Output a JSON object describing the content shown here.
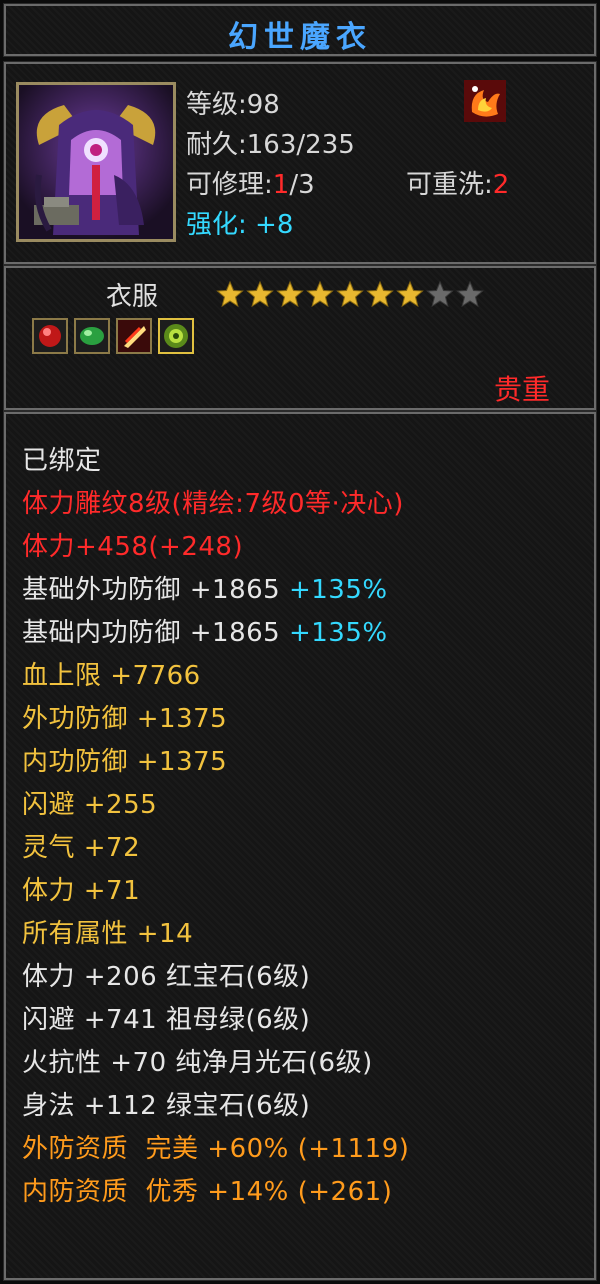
{
  "item": {
    "name": "幻世魔衣",
    "level_label": "等级:",
    "level": "98",
    "durability_label": "耐久:",
    "durability": "163/235",
    "repair_label": "可修理:",
    "repair_current": "1",
    "repair_max": "/3",
    "rewash_label": "可重洗:",
    "rewash_value": "2",
    "enhance_label": "强化: ",
    "enhance_value": "+8",
    "slot": "衣服",
    "stars_total": 9,
    "stars_filled": 7,
    "rarity": "贵重",
    "icon": "costume-armor-icon",
    "badge_icon": "flame-bird-badge-icon",
    "gem_icons": [
      "ruby-gem-icon",
      "emerald-gem-icon",
      "fire-gem-icon",
      "moonstone-gem-icon"
    ]
  },
  "stats": [
    {
      "parts": [
        {
          "text": "已绑定",
          "color": "white"
        }
      ]
    },
    {
      "parts": [
        {
          "text": "体力雕纹8级(精绘:7级0等·决心)",
          "color": "red"
        }
      ]
    },
    {
      "parts": [
        {
          "text": "体力+458(+248)",
          "color": "red"
        }
      ]
    },
    {
      "parts": [
        {
          "text": "基础外功防御 +1865 ",
          "color": "white"
        },
        {
          "text": "+135%",
          "color": "cyan"
        }
      ]
    },
    {
      "parts": [
        {
          "text": "基础内功防御 +1865 ",
          "color": "white"
        },
        {
          "text": "+135%",
          "color": "cyan"
        }
      ]
    },
    {
      "parts": [
        {
          "text": "血上限 +7766",
          "color": "gold"
        }
      ]
    },
    {
      "parts": [
        {
          "text": "外功防御 +1375",
          "color": "gold"
        }
      ]
    },
    {
      "parts": [
        {
          "text": "内功防御 +1375",
          "color": "gold"
        }
      ]
    },
    {
      "parts": [
        {
          "text": "闪避 +255",
          "color": "gold"
        }
      ]
    },
    {
      "parts": [
        {
          "text": "灵气 +72",
          "color": "gold"
        }
      ]
    },
    {
      "parts": [
        {
          "text": "体力 +71",
          "color": "gold"
        }
      ]
    },
    {
      "parts": [
        {
          "text": "所有属性 +14",
          "color": "gold"
        }
      ]
    },
    {
      "parts": [
        {
          "text": "体力 +206 红宝石(6级)",
          "color": "white"
        }
      ]
    },
    {
      "parts": [
        {
          "text": "闪避 +741 祖母绿(6级)",
          "color": "white"
        }
      ]
    },
    {
      "parts": [
        {
          "text": "火抗性 +70 纯净月光石(6级)",
          "color": "white"
        }
      ]
    },
    {
      "parts": [
        {
          "text": "身法 +112 绿宝石(6级)",
          "color": "white"
        }
      ]
    },
    {
      "parts": [
        {
          "text": "外防资质  完美 +60% (+1119)",
          "color": "orange"
        }
      ]
    },
    {
      "parts": [
        {
          "text": "内防资质  优秀 +14% (+261)",
          "color": "orange"
        }
      ]
    }
  ]
}
